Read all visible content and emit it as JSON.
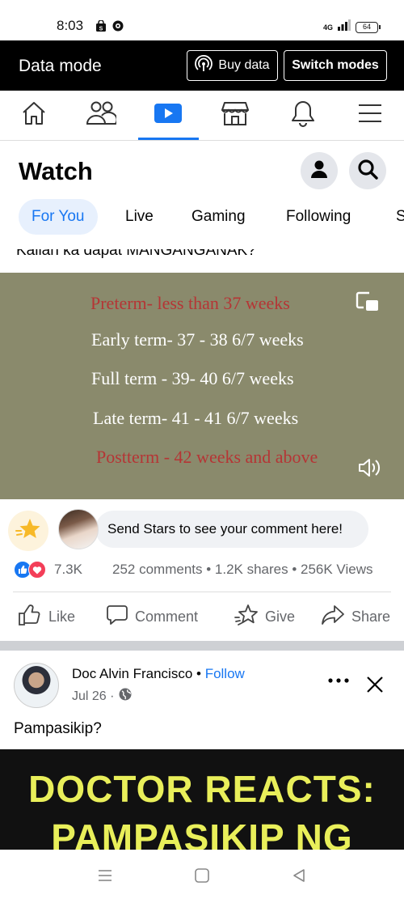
{
  "status_bar": {
    "time": "8:03",
    "network": "4G",
    "battery": "64"
  },
  "data_bar": {
    "title": "Data mode",
    "buy_label": "Buy data",
    "switch_label": "Switch modes"
  },
  "nav": {
    "items": [
      "home-icon",
      "friends-icon",
      "watch-icon",
      "marketplace-icon",
      "notifications-icon",
      "menu-icon"
    ],
    "active": "watch",
    "accent": "#1877f2"
  },
  "watch": {
    "title": "Watch",
    "tabs": [
      "For You",
      "Live",
      "Gaming",
      "Following",
      "S"
    ],
    "active_tab": "For You"
  },
  "post1": {
    "clipped_caption": "Kailan ka dapat MANGANGANAK?",
    "video_lines": [
      {
        "text": "Preterm- less than 37 weeks",
        "color": "#b53535"
      },
      {
        "text": "Early term- 37 - 38 6/7 weeks",
        "color": "#ffffff"
      },
      {
        "text": "Full term - 39- 40 6/7 weeks",
        "color": "#ffffff"
      },
      {
        "text": "Late term- 41 - 41 6/7 weeks",
        "color": "#ffffff"
      },
      {
        "text": "Postterm - 42 weeks and above",
        "color": "#b53535"
      }
    ],
    "stars_prompt": "Send Stars to see your comment here!",
    "reaction_count": "7.3K",
    "engagement": "252 comments • 1.2K shares • 256K Views",
    "actions": {
      "like": "Like",
      "comment": "Comment",
      "give": "Give",
      "share": "Share"
    }
  },
  "post2": {
    "author": "Doc Alvin Francisco",
    "separator": " • ",
    "follow": "Follow",
    "date": "Jul 26 ·",
    "text": "Pampasikip?",
    "thumb_line1": "DOCTOR REACTS:",
    "thumb_line2": "PAMPASIKIP NG"
  }
}
